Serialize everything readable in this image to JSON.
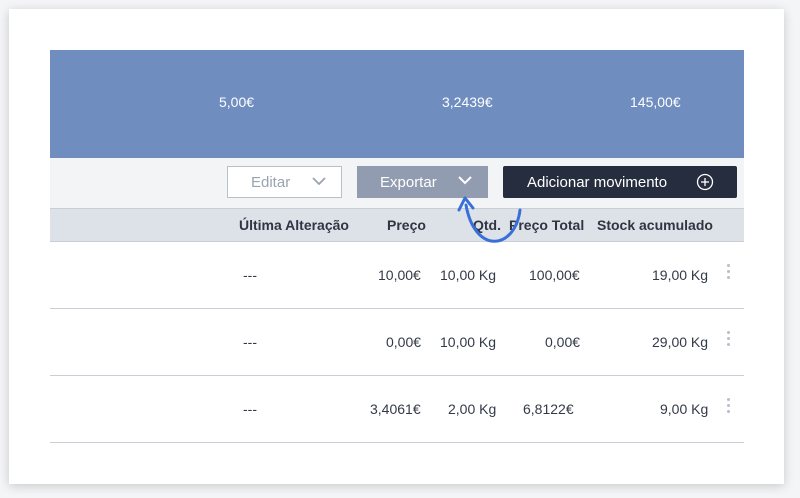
{
  "summary": {
    "value_1": "5,00€",
    "value_2": "3,2439€",
    "value_3": "145,00€"
  },
  "toolbar": {
    "edit_label": "Editar",
    "export_label": "Exportar",
    "add_label": "Adicionar movimento"
  },
  "table": {
    "headers": {
      "last_change": "Última Alteração",
      "price": "Preço",
      "qty": "Qtd.",
      "total_price": "Preço Total",
      "stock": "Stock acumulado"
    },
    "rows": [
      {
        "last_change": "---",
        "price": "10,00€",
        "qty": "10,00 Kg",
        "total": "100,00€",
        "stock": "19,00 Kg"
      },
      {
        "last_change": "---",
        "price": "0,00€",
        "qty": "10,00 Kg",
        "total": "0,00€",
        "stock": "29,00 Kg"
      },
      {
        "last_change": "---",
        "price": "3,4061€",
        "qty": "2,00 Kg",
        "total": "6,8122€",
        "stock": "9,00 Kg"
      }
    ]
  },
  "colors": {
    "summary_bg": "#6f8ebf",
    "export_bg": "#929cb0",
    "add_bg": "#252d3e",
    "annotation_arrow": "#3a6fd8"
  },
  "icons": [
    "chevron-down-icon",
    "plus-circle-icon",
    "kebab-menu-icon",
    "annotation-arrow"
  ]
}
